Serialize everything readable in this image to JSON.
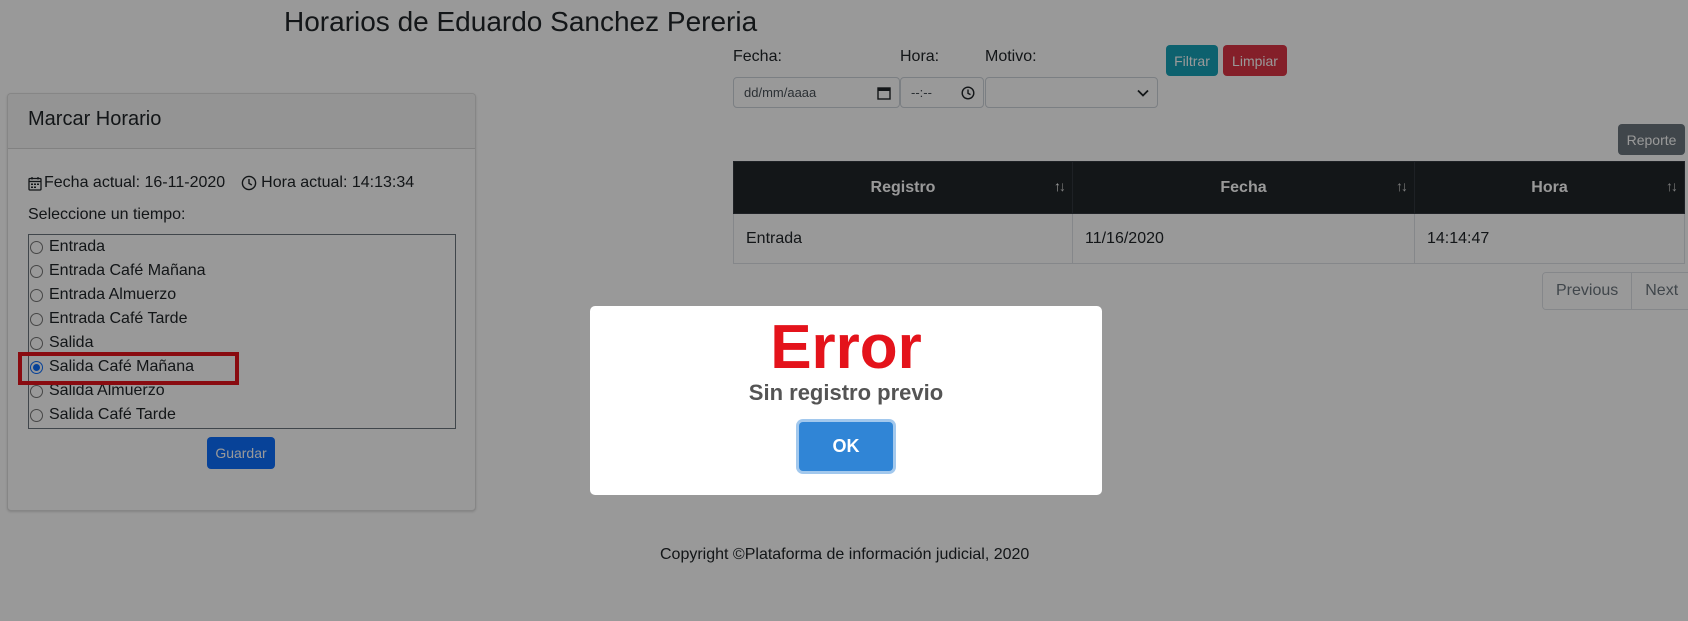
{
  "page_title": "Horarios de Eduardo Sanchez Pereria",
  "card": {
    "title": "Marcar Horario",
    "fecha_actual": "Fecha actual: 16-11-2020",
    "hora_actual": "Hora actual: 14:13:34",
    "select_label": "Seleccione un tiempo:",
    "options": [
      "Entrada",
      "Entrada Café Mañana",
      "Entrada Almuerzo",
      "Entrada Café Tarde",
      "Salida",
      "Salida Café Mañana",
      "Salida Almuerzo",
      "Salida Café Tarde"
    ],
    "selected_option": "Salida Café Mañana",
    "save_label": "Guardar"
  },
  "filters": {
    "fecha_label": "Fecha:",
    "hora_label": "Hora:",
    "motivo_label": "Motivo:",
    "fecha_placeholder": "dd/mm/aaaa",
    "hora_placeholder": "--:--",
    "motivo_value": "",
    "filtrar_label": "Filtrar",
    "limpiar_label": "Limpiar"
  },
  "reporte_label": "Reporte",
  "table": {
    "headers": [
      "Registro",
      "Fecha",
      "Hora"
    ],
    "rows": [
      [
        "Entrada",
        "11/16/2020",
        "14:14:47"
      ]
    ]
  },
  "pagination": {
    "previous_label": "Previous",
    "next_label": "Next"
  },
  "footer": "Copyright ©Plataforma de información judicial, 2020",
  "modal": {
    "title": "Error",
    "text": "Sin registro previo",
    "ok_label": "OK"
  },
  "colors": {
    "primary": "#0d6efd",
    "info": "#17a2b8",
    "danger": "#dc3545",
    "secondary": "#6c757d",
    "dark": "#212529",
    "error": "#e4131b",
    "modal_ok": "#3085d6"
  },
  "icons": {
    "calendar": "calendar-icon",
    "clock": "clock-icon",
    "sort": "sort-icon"
  }
}
